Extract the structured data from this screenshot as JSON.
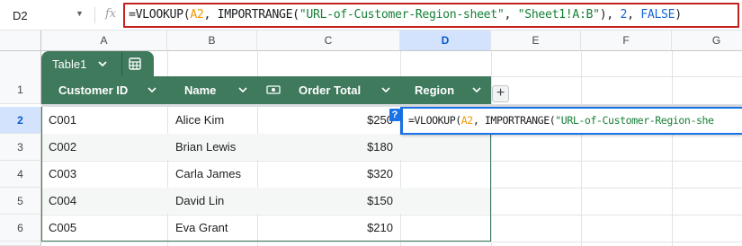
{
  "formula_bar": {
    "name_box": "D2",
    "fx_label": "fx",
    "formula": {
      "fn": "=VLOOKUP(",
      "ref": "A2",
      "sep1": ", IMPORTRANGE(",
      "url": "\"URL-of-Customer-Region-sheet\"",
      "sep2": ", ",
      "range": "\"Sheet1!A:B\"",
      "sep3": "), ",
      "col": "2",
      "sep4": ", ",
      "flag": "FALSE",
      "end": ")"
    }
  },
  "columns": [
    "A",
    "B",
    "C",
    "D",
    "E",
    "F",
    "G"
  ],
  "selected_column": "D",
  "rows": [
    "1",
    "2",
    "3",
    "4",
    "5",
    "6"
  ],
  "selected_row": "2",
  "table": {
    "name": "Table1",
    "headers": [
      "Customer ID",
      "Name",
      "Order Total",
      "Region"
    ],
    "records": [
      {
        "id": "C001",
        "name": "Alice Kim",
        "total": "$250"
      },
      {
        "id": "C002",
        "name": "Brian Lewis",
        "total": "$180"
      },
      {
        "id": "C003",
        "name": "Carla James",
        "total": "$320"
      },
      {
        "id": "C004",
        "name": "David Lin",
        "total": "$150"
      },
      {
        "id": "C005",
        "name": "Eva Grant",
        "total": "$210"
      }
    ],
    "add_column_label": "+"
  },
  "cell_editor": {
    "help_label": "?",
    "formula": {
      "fn": "=VLOOKUP(",
      "ref": "A2",
      "sep1": ", IMPORTRANGE(",
      "url": "\"URL-of-Customer-Region-she"
    }
  },
  "colors": {
    "table_header": "#3f7a5d",
    "selection": "#1a73e8",
    "formula_border": "#c5221f"
  },
  "icons": {
    "name_box_dropdown": "caret-down-icon",
    "function": "fx-icon",
    "column_menu": "chevron-down-icon",
    "table_view": "grid-icon",
    "currency_column": "currency-icon"
  }
}
